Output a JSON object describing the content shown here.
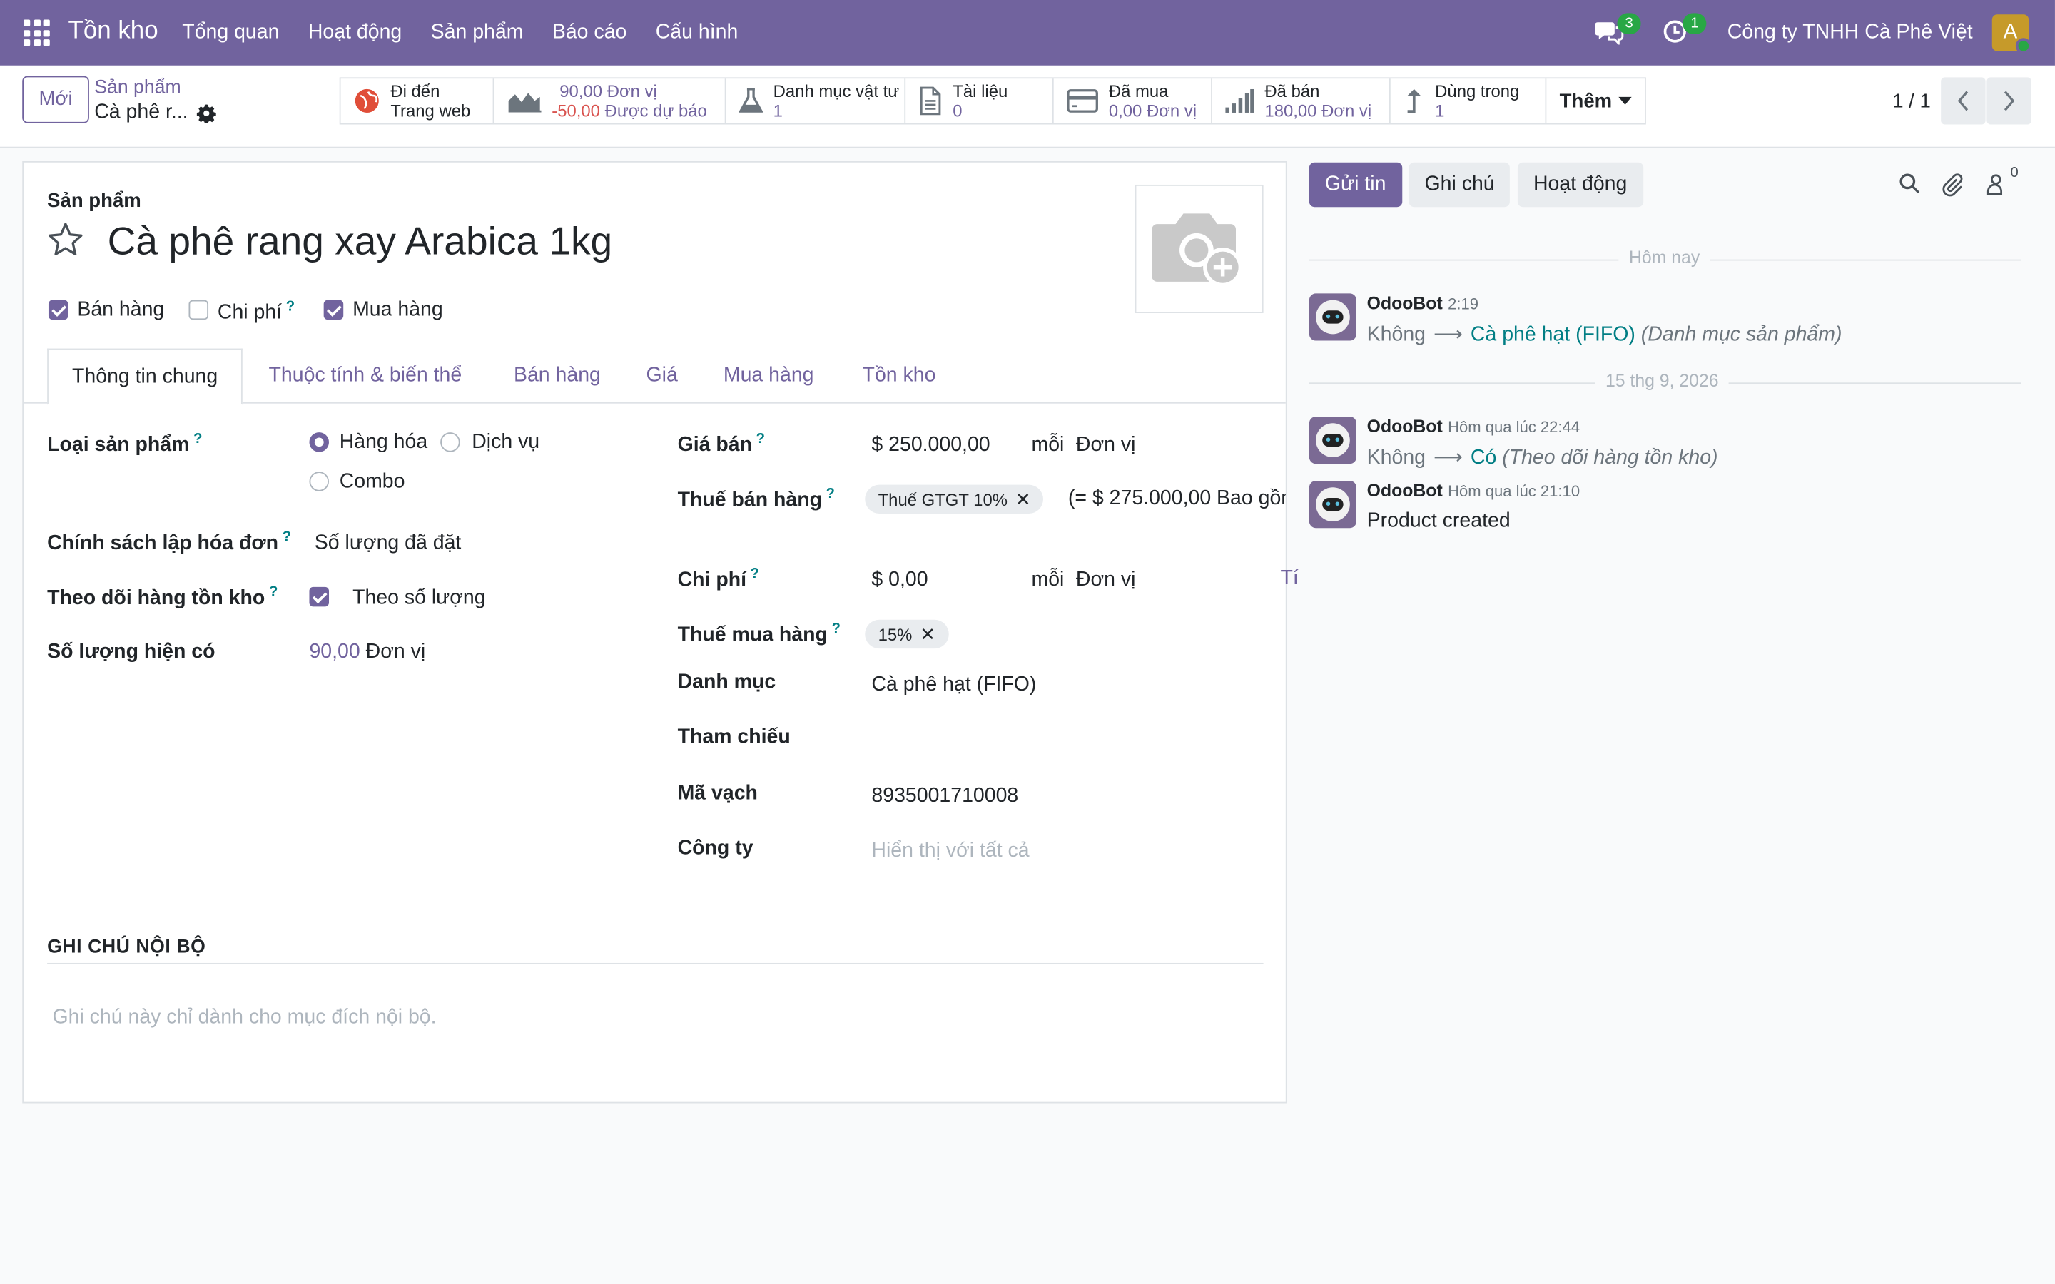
{
  "navbar": {
    "app_name": "Tồn kho",
    "menu": [
      "Tổng quan",
      "Hoạt động",
      "Sản phẩm",
      "Báo cáo",
      "Cấu hình"
    ],
    "messages_count": "3",
    "activities_count": "1",
    "company": "Công ty TNHH Cà Phê Việt",
    "avatar_letter": "A"
  },
  "control": {
    "new_button": "Mới",
    "breadcrumb_parent": "Sản phẩm",
    "breadcrumb_current": "Cà phê r...",
    "pager": "1 / 1",
    "more_label": "Thêm",
    "stats": {
      "website_line1": "Đi đến",
      "website_line2": "Trang web",
      "onhand_value": "90,00",
      "onhand_unit": "Đơn vị",
      "forecast_value": "-50,00",
      "forecast_label": "Được dự báo",
      "bom_label": "Danh mục vật tư",
      "bom_value": "1",
      "docs_label": "Tài liệu",
      "docs_value": "0",
      "purchased_label": "Đã mua",
      "purchased_value": "0,00 Đơn vị",
      "sold_label": "Đã bán",
      "sold_value": "180,00 Đơn vị",
      "used_label": "Dùng trong",
      "used_value": "1"
    }
  },
  "form": {
    "title_label": "Sản phẩm",
    "product_name": "Cà phê rang xay Arabica 1kg",
    "checks": {
      "sale": {
        "label": "Bán hàng",
        "checked": true
      },
      "expense": {
        "label": "Chi phí",
        "checked": false
      },
      "purchase": {
        "label": "Mua hàng",
        "checked": true
      }
    },
    "tabs": [
      "Thông tin chung",
      "Thuộc tính & biến thể",
      "Bán hàng",
      "Giá",
      "Mua hàng",
      "Tồn kho"
    ],
    "left": {
      "type_label": "Loại sản phẩm",
      "type_options": [
        "Hàng hóa",
        "Dịch vụ",
        "Combo"
      ],
      "type_selected": "Hàng hóa",
      "invoice_policy_label": "Chính sách lập hóa đơn",
      "invoice_policy_value": "Số lượng đã đặt",
      "track_label": "Theo dõi hàng tồn kho",
      "track_value": "Theo số lượng",
      "qty_label": "Số lượng hiện có",
      "qty_value": "90,00",
      "qty_unit": "Đơn vị"
    },
    "right": {
      "price_label": "Giá bán",
      "price_value": "$ 250.000,00",
      "per": "mỗi",
      "unit": "Đơn vị",
      "sale_tax_label": "Thuế bán hàng",
      "sale_tax_tag": "Thuế GTGT 10%",
      "sale_tax_note": "(= $ 275.000,00 Bao gồm",
      "cost_label": "Chi phí",
      "cost_value": "$ 0,00",
      "cost_link": "Tí",
      "purchase_tax_label": "Thuế mua hàng",
      "purchase_tax_tag": "15%",
      "category_label": "Danh mục",
      "category_value": "Cà phê hạt (FIFO)",
      "ref_label": "Tham chiếu",
      "barcode_label": "Mã vạch",
      "barcode_value": "8935001710008",
      "company_label": "Công ty",
      "company_placeholder": "Hiển thị với tất cả"
    },
    "notes_heading": "GHI CHÚ NỘI BỘ",
    "notes_placeholder": "Ghi chú này chỉ dành cho mục đích nội bộ."
  },
  "chatter": {
    "send_message": "Gửi tin",
    "log_note": "Ghi chú",
    "activity": "Hoạt động",
    "followers_count": "0",
    "sep_today": "Hôm nay",
    "sep_date": "15 thg 9, 2026",
    "messages": [
      {
        "author": "OdooBot",
        "time": "2:19",
        "old": "Không",
        "new": "Cà phê hạt (FIFO)",
        "field": "(Danh mục sản phẩm)"
      },
      {
        "author": "OdooBot",
        "time": "Hôm qua lúc 22:44",
        "old": "Không",
        "new": "Có",
        "field": "(Theo dõi hàng tồn kho)"
      },
      {
        "author": "OdooBot",
        "time": "Hôm qua lúc 21:10",
        "body": "Product created"
      }
    ]
  },
  "colors": {
    "brand": "#71639e",
    "link_teal": "#017e84",
    "negative": "#d9534f",
    "success": "#28a745"
  }
}
